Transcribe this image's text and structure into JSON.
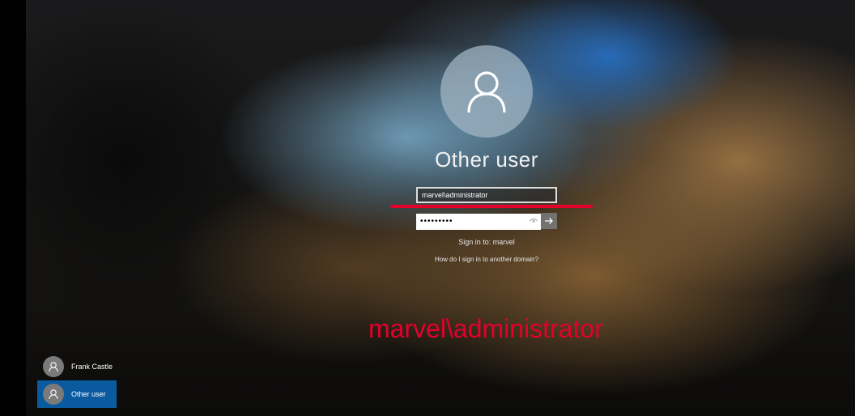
{
  "login": {
    "title": "Other user",
    "username_value": "marvel\\administrator",
    "password_value": "•••••••••",
    "sign_in_to": "Sign in to: marvel",
    "domain_help_link": "How do I sign in to another domain?"
  },
  "annotation": {
    "text": "marvel\\administrator",
    "color": "#e4002b"
  },
  "user_list": [
    {
      "name": "Frank Castle",
      "selected": false
    },
    {
      "name": "Other user",
      "selected": true
    }
  ],
  "colors": {
    "selected_user_bg": "#0a5aa0",
    "annotation_red": "#e4002b"
  },
  "icons": {
    "avatar": "user-silhouette-icon",
    "reveal": "eye-icon",
    "submit": "arrow-right-icon"
  }
}
